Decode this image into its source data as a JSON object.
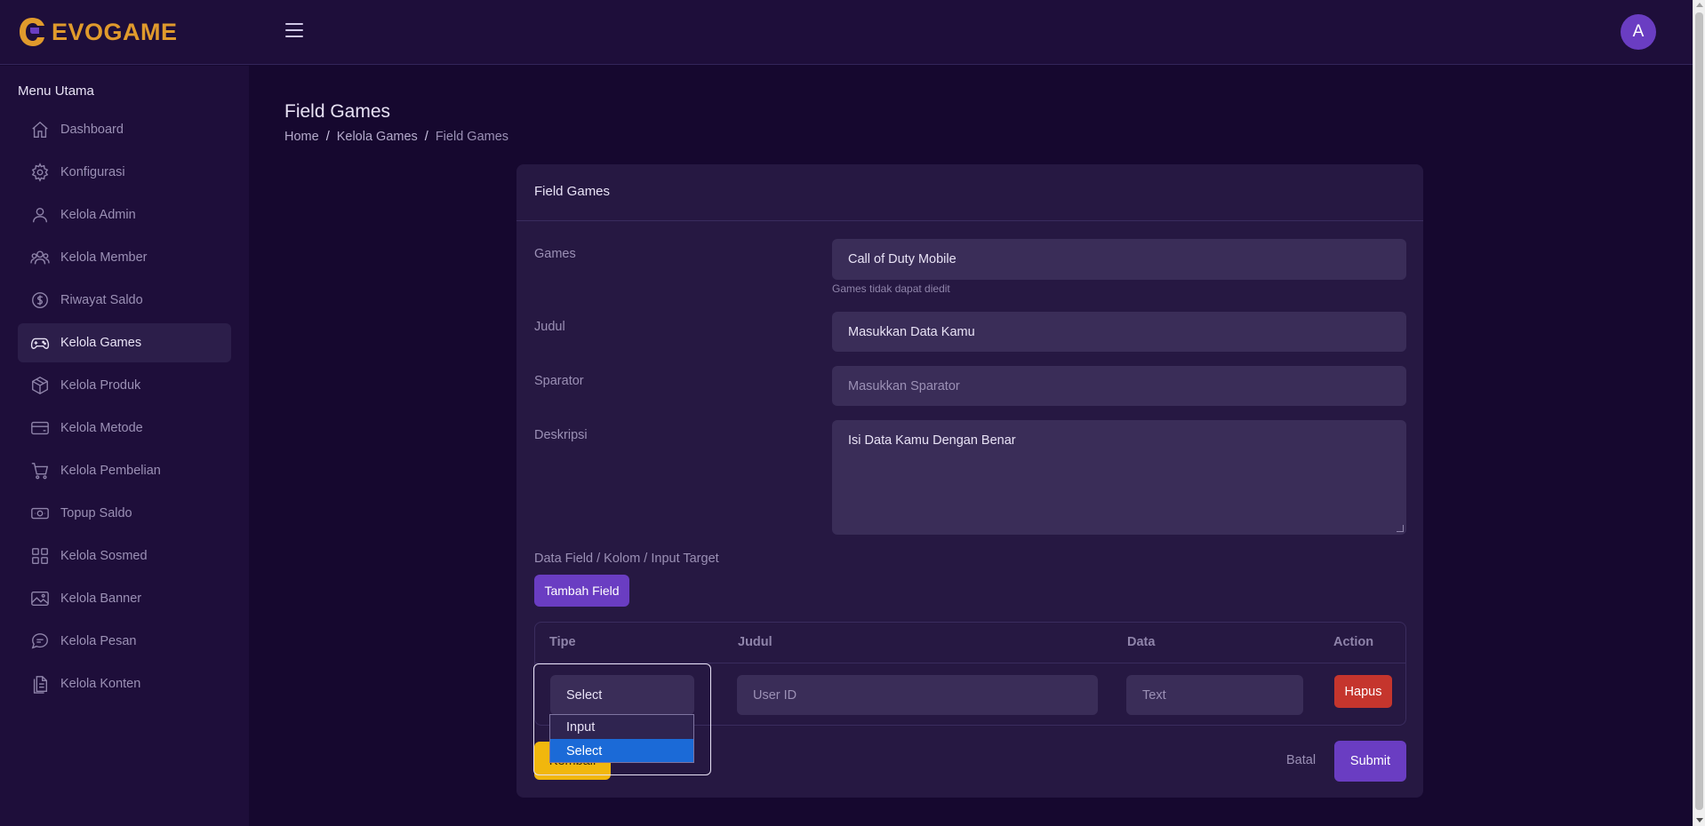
{
  "brand": {
    "name": "EVOGAME",
    "accent": "#e09a2c",
    "primary": "#6a3dc2"
  },
  "header": {
    "avatar_initial": "A"
  },
  "sidebar": {
    "title": "Menu Utama",
    "items": [
      {
        "label": "Dashboard",
        "icon": "home-icon"
      },
      {
        "label": "Konfigurasi",
        "icon": "gear-icon"
      },
      {
        "label": "Kelola Admin",
        "icon": "user-icon"
      },
      {
        "label": "Kelola Member",
        "icon": "users-icon"
      },
      {
        "label": "Riwayat Saldo",
        "icon": "dollar-circle-icon"
      },
      {
        "label": "Kelola Games",
        "icon": "gamepad-icon",
        "active": true
      },
      {
        "label": "Kelola Produk",
        "icon": "box-icon"
      },
      {
        "label": "Kelola Metode",
        "icon": "credit-card-icon"
      },
      {
        "label": "Kelola Pembelian",
        "icon": "cart-icon"
      },
      {
        "label": "Topup Saldo",
        "icon": "cash-icon"
      },
      {
        "label": "Kelola Sosmed",
        "icon": "grid-icon"
      },
      {
        "label": "Kelola Banner",
        "icon": "image-icon"
      },
      {
        "label": "Kelola Pesan",
        "icon": "chat-icon"
      },
      {
        "label": "Kelola Konten",
        "icon": "document-icon"
      }
    ]
  },
  "page": {
    "title": "Field Games",
    "breadcrumb": [
      "Home",
      "Kelola Games",
      "Field Games"
    ]
  },
  "form": {
    "card_title": "Field Games",
    "games": {
      "label": "Games",
      "value": "Call of Duty Mobile",
      "help": "Games tidak dapat diedit"
    },
    "judul": {
      "label": "Judul",
      "value": "Masukkan Data Kamu"
    },
    "sparator": {
      "label": "Sparator",
      "placeholder": "Masukkan Sparator"
    },
    "deskripsi": {
      "label": "Deskripsi",
      "value": "Isi Data Kamu Dengan Benar"
    },
    "section_label": "Data Field / Kolom / Input Target",
    "add_field_label": "Tambah Field",
    "table": {
      "headers": [
        "Tipe",
        "Judul",
        "Data",
        "Action"
      ],
      "row": {
        "tipe": "Select",
        "judul": "User ID",
        "data": "Text",
        "action": "Hapus"
      }
    },
    "tipe_options": [
      "Input",
      "Select"
    ],
    "tipe_selected": "Select",
    "back_label": "Kembali",
    "cancel_label": "Batal",
    "submit_label": "Submit"
  }
}
